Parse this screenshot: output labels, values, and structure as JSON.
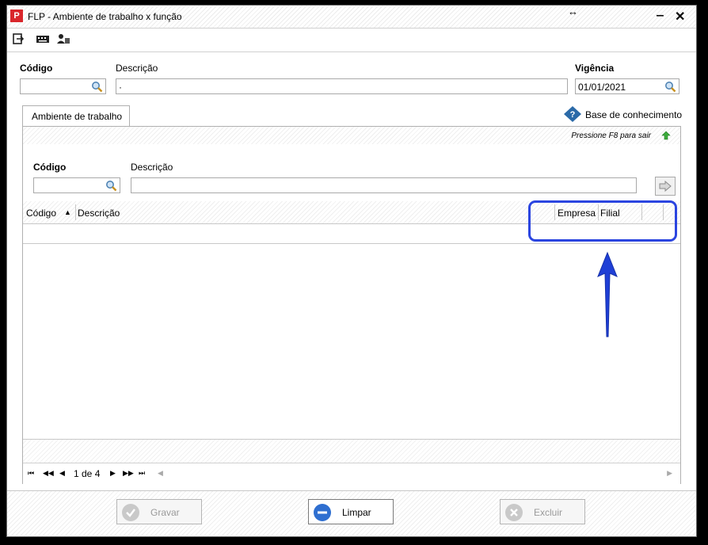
{
  "window": {
    "title": "FLP - Ambiente de trabalho x função",
    "logo_text": "P"
  },
  "form": {
    "codigo_label": "Código",
    "descricao_label": "Descrição",
    "descricao_value": "·",
    "vigencia_label": "Vigência",
    "vigencia_value": "01/01/2021"
  },
  "tab": {
    "label": "Ambiente de trabalho"
  },
  "knowledge": {
    "label": "Base de conhecimento"
  },
  "panel": {
    "hint": "Pressione F8 para sair",
    "codigo_label": "Código",
    "descricao_label": "Descrição"
  },
  "grid": {
    "columns": [
      "Código",
      "Descrição",
      "Empresa",
      "Filial"
    ],
    "sort_indicator": "▲"
  },
  "pager": {
    "first": "⏮",
    "text": "1 de 4"
  },
  "buttons": {
    "gravar": "Gravar",
    "limpar": "Limpar",
    "excluir": "Excluir"
  },
  "colors": {
    "accent_blue": "#2b45e0",
    "brand_red": "#d9262b"
  }
}
